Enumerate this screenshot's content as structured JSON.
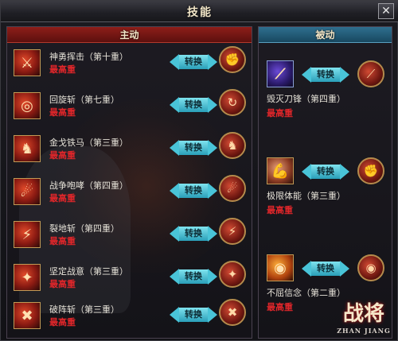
{
  "window": {
    "title": "技能",
    "close_label": "✕"
  },
  "active": {
    "header": "主动",
    "skills": [
      {
        "name": "神勇挥击（第十重）",
        "level": "最高重",
        "switch": "转换"
      },
      {
        "name": "回旋斩（第七重）",
        "level": "最高重",
        "switch": "转换"
      },
      {
        "name": "金戈铁马（第三重）",
        "level": "最高重",
        "switch": "转换"
      },
      {
        "name": "战争咆哮（第四重）",
        "level": "最高重",
        "switch": "转换"
      },
      {
        "name": "裂地斩（第四重）",
        "level": "最高重",
        "switch": "转换"
      },
      {
        "name": "坚定战意（第三重）",
        "level": "最高重",
        "switch": "转换"
      },
      {
        "name": "破阵斩（第三重）",
        "level": "最高重",
        "switch": "转换"
      }
    ]
  },
  "passive": {
    "header": "被动",
    "skills": [
      {
        "name": "毁灭刀锋（第四重）",
        "level": "最高重",
        "switch": "转换"
      },
      {
        "name": "极限体能（第三重）",
        "level": "最高重",
        "switch": "转换"
      },
      {
        "name": "不屈信念（第二重）",
        "level": "最高重",
        "switch": "转换"
      }
    ]
  },
  "logo": {
    "main": "战将",
    "sub": "ZHAN JIANG"
  },
  "colors": {
    "level_red": "#e0262a",
    "switch_cyan": "#49c4d8",
    "active_header": "#8e1e19",
    "passive_header": "#2f6f8f"
  }
}
